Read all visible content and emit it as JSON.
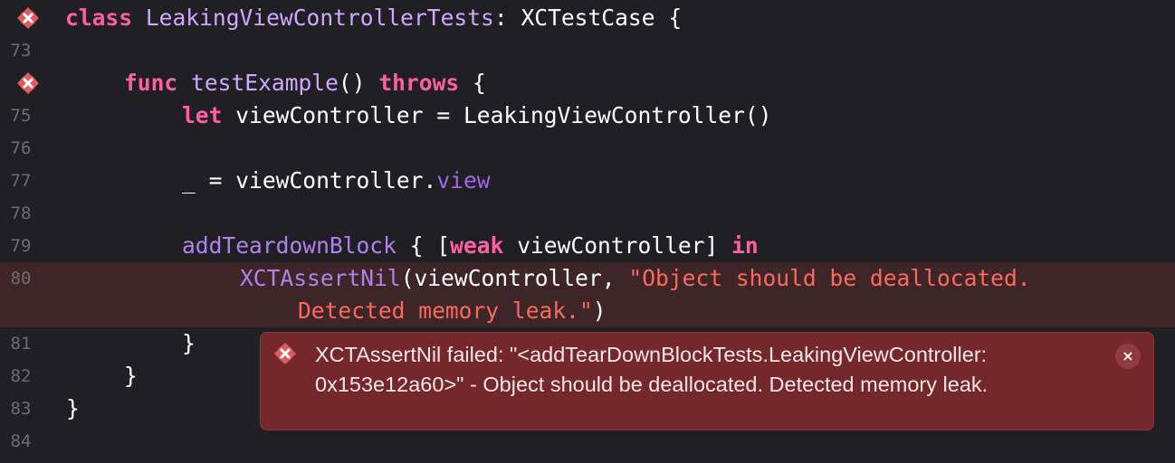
{
  "editor": {
    "lines": [
      {
        "number": "",
        "error": true,
        "code": [
          "class",
          " LeakingViewControllerTests",
          ": ",
          "XCTestCase",
          " {"
        ]
      },
      {
        "number": "73"
      },
      {
        "number": "",
        "error": true,
        "code": [
          "func",
          " ",
          "testExample",
          "() ",
          "throws",
          " {"
        ]
      },
      {
        "number": "75",
        "code": [
          "let",
          " viewController = ",
          "LeakingViewController",
          "()"
        ]
      },
      {
        "number": "76"
      },
      {
        "number": "77",
        "code": [
          "_ = viewController.",
          "view"
        ]
      },
      {
        "number": "78"
      },
      {
        "number": "79",
        "code": [
          "addTeardownBlock",
          " { [",
          "weak",
          " viewController] ",
          "in"
        ]
      },
      {
        "number": "80",
        "code": [
          "XCTAssertNil",
          "(viewController, ",
          "\"Object should be deallocated."
        ]
      },
      {
        "number": "",
        "code": [
          "Detected memory leak.\"",
          ")"
        ]
      },
      {
        "number": "81",
        "code": [
          "}"
        ]
      },
      {
        "number": "82",
        "code": [
          "}"
        ]
      },
      {
        "number": "83",
        "code": [
          "}"
        ]
      },
      {
        "number": "84"
      }
    ]
  },
  "error_popup": {
    "message_line1": "XCTAssertNil failed: \"<addTearDownBlockTests.LeakingViewController:",
    "message_line2": "0x153e12a60>\" - Object should be deallocated. Detected memory leak.",
    "close_label": "×"
  },
  "colors": {
    "background": "#1f1f24",
    "keyword": "#fc5fa3",
    "type": "#d0a8ff",
    "string": "#fc6a5d",
    "error_highlight": "#3d2528",
    "popup_background": "#74282c"
  },
  "icons": {
    "error_marker": "error-x-icon",
    "close": "close-icon"
  }
}
